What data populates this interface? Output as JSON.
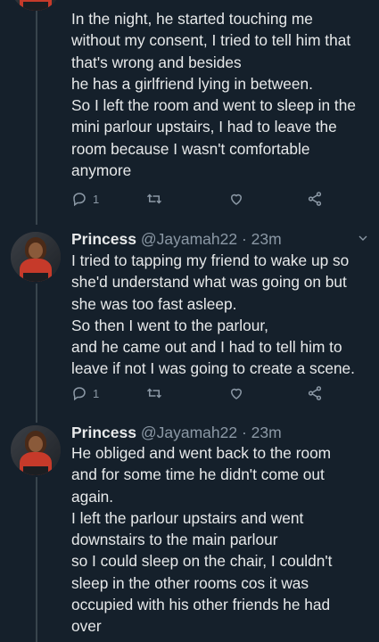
{
  "tweets": [
    {
      "lines": [
        "In the night, he started touching me",
        "without my consent, I tried to tell him that",
        "that's wrong and besides",
        "he has a girlfriend lying in between.",
        "So I left the room and went to sleep in the",
        "mini parlour upstairs, I had to leave the",
        "room because I wasn't comfortable",
        "anymore"
      ],
      "reply_count": "1"
    },
    {
      "name": "Princess",
      "handle": "@Jayamah22",
      "time": "· 23m",
      "lines": [
        "I tried to tapping my friend to wake up so",
        "she'd understand what was going on but",
        "she was too fast asleep.",
        "So then I went to the parlour,",
        "and he came out and I had to tell him to",
        "leave if not I was going to create a scene."
      ],
      "reply_count": "1"
    },
    {
      "name": "Princess",
      "handle": "@Jayamah22",
      "time": "· 23m",
      "lines": [
        "He obliged and went back to the room",
        "and for some time he didn't come out",
        "again.",
        "I left the parlour upstairs and went",
        "downstairs to the main parlour",
        "so I could sleep on the chair, I couldn't",
        "sleep in the other rooms cos it was",
        "occupied with his other friends he had",
        "over"
      ]
    }
  ],
  "colors": {
    "background": "#15202b",
    "text": "#e7e9ea",
    "muted": "#8b98a5",
    "line": "#38444d"
  },
  "icons": [
    "reply-icon",
    "retweet-icon",
    "like-icon",
    "share-icon",
    "chevron-down-icon"
  ]
}
